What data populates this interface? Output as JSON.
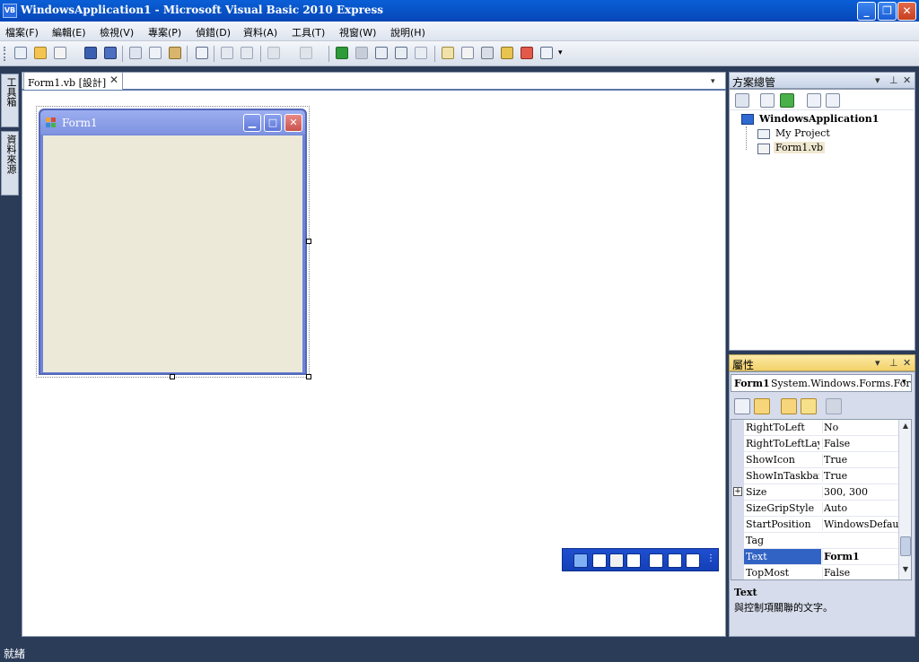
{
  "window": {
    "icon_text": "VB",
    "title": "WindowsApplication1 - Microsoft Visual Basic 2010 Express",
    "minimize": "_",
    "maximize": "❐",
    "close": "✕"
  },
  "menu": [
    "檔案(F)",
    "編輯(E)",
    "檢視(V)",
    "專案(P)",
    "偵錯(D)",
    "資料(A)",
    "工具(T)",
    "視窗(W)",
    "說明(H)"
  ],
  "toolbar_icons": [
    "add-project-icon",
    "open-icon",
    "add-item-icon",
    "save-icon",
    "save-all-icon",
    "cut-icon",
    "copy-icon",
    "paste-icon",
    "find-icon",
    "comment-icon",
    "uncomment-icon",
    "undo-icon",
    "redo-icon",
    "start-debug-icon",
    "stop-icon",
    "step-into-icon",
    "step-over-icon",
    "step-out-icon",
    "solution-explorer-icon",
    "properties-icon",
    "toolbox-icon",
    "object-browser-icon",
    "error-list-icon",
    "immediate-window-icon"
  ],
  "left_tabs": {
    "toolbox": "工具箱",
    "datasources": "資料來源"
  },
  "document": {
    "tab_label": "Form1.vb [設計]",
    "tab_close": "✕",
    "dropdown": "▾"
  },
  "designer_form": {
    "title": "Form1",
    "minimize": "▁",
    "maximize": "□",
    "close": "✕"
  },
  "solution_explorer": {
    "title": "方案總管",
    "root": "WindowsApplication1",
    "items": [
      "My Project",
      "Form1.vb"
    ]
  },
  "properties": {
    "title": "屬性",
    "object_name": "Form1",
    "object_type": "System.Windows.Forms.Form",
    "rows": [
      {
        "name": "RightToLeft",
        "value": "No"
      },
      {
        "name": "RightToLeftLayout",
        "value": "False"
      },
      {
        "name": "ShowIcon",
        "value": "True"
      },
      {
        "name": "ShowInTaskbar",
        "value": "True"
      },
      {
        "name": "Size",
        "value": "300, 300",
        "expand": "+"
      },
      {
        "name": "SizeGripStyle",
        "value": "Auto"
      },
      {
        "name": "StartPosition",
        "value": "WindowsDefaultLocation"
      },
      {
        "name": "Tag",
        "value": ""
      },
      {
        "name": "Text",
        "value": "Form1"
      },
      {
        "name": "TopMost",
        "value": "False"
      }
    ],
    "selected_row": "Text",
    "description_title": "Text",
    "description": "與控制項關聯的文字。"
  },
  "status": {
    "text": "就緒"
  },
  "colors": {
    "titlebar": "#0a5fd6",
    "selection": "#3163c5",
    "form_caption": "#7e93e0",
    "form_client": "#ece9d8"
  }
}
